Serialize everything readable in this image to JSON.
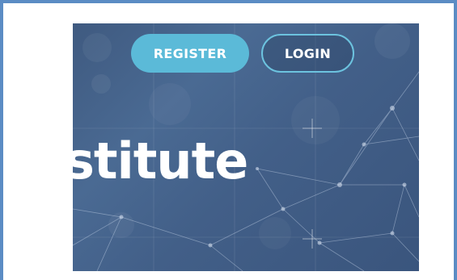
{
  "header": {
    "register_label": "REGISTER",
    "login_label": "LOGIN"
  },
  "hero": {
    "title_fragment": "stitute"
  },
  "colors": {
    "frame_border": "#5b8cc4",
    "hero_background": "#445f86",
    "register_button": "#5bbad8",
    "login_border": "#6cc3df",
    "text": "#ffffff"
  }
}
